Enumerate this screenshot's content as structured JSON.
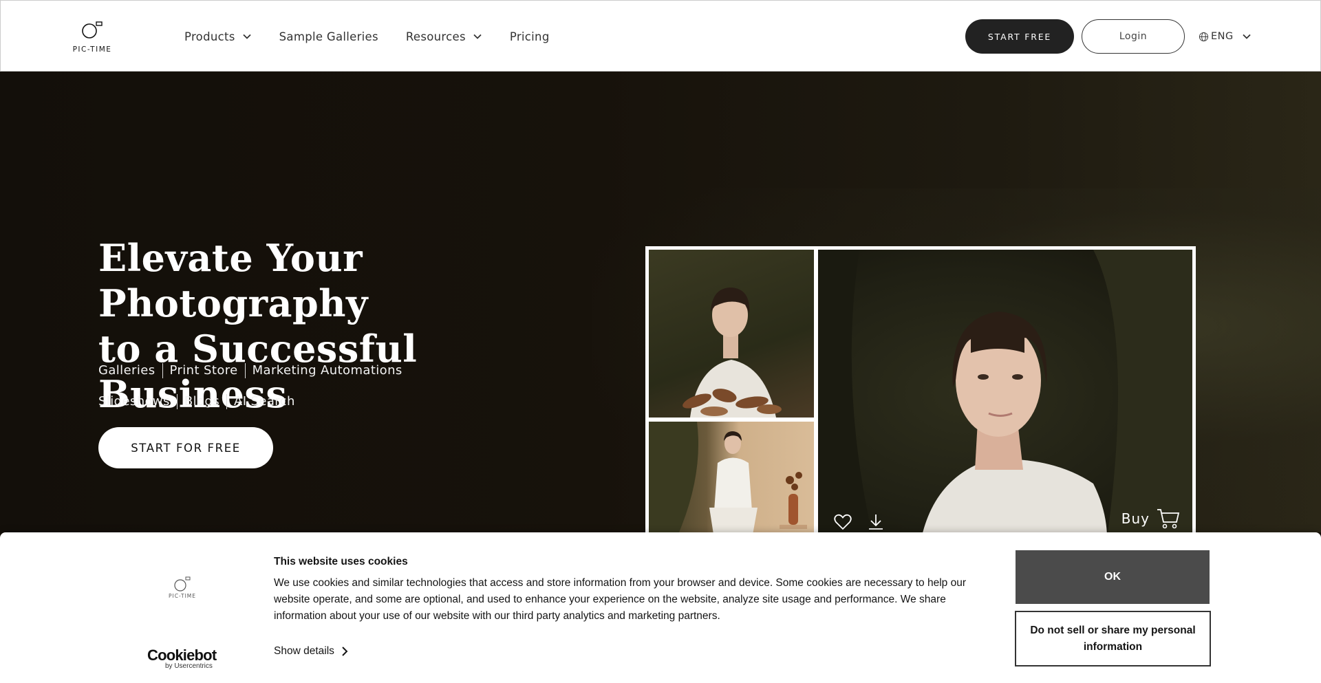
{
  "brand": {
    "name": "PIC-TIME"
  },
  "nav": {
    "items": [
      {
        "label": "Products",
        "has_dropdown": true
      },
      {
        "label": "Sample Galleries",
        "has_dropdown": false
      },
      {
        "label": "Resources",
        "has_dropdown": true
      },
      {
        "label": "Pricing",
        "has_dropdown": false
      }
    ],
    "start_free": "START FREE",
    "login": "Login",
    "language": "ENG"
  },
  "hero": {
    "title_line1": "Elevate Your Photography",
    "title_line2": "to a Successful Business",
    "features_row1": [
      "Galleries",
      "Print Store",
      "Marketing Automations"
    ],
    "features_row2": [
      "Slideshows",
      "Blogs",
      "AI Search"
    ],
    "cta": "START FOR FREE",
    "gallery_buy": "Buy"
  },
  "cookie": {
    "title": "This website uses cookies",
    "body": "We use cookies and similar technologies that access and store information from your browser and device. Some cookies are necessary to help our website operate, and some are optional, and used to enhance your experience on the website, analyze site usage and performance. We share information about your use of our website with our third party analytics and marketing partners.",
    "show_details": "Show details",
    "ok": "OK",
    "do_not_sell": "Do not sell or share my personal information",
    "provider": "Cookiebot",
    "provider_sub": "by Usercentrics"
  },
  "colors": {
    "nav_bg": "#ffffff",
    "hero_bg": "#15100a",
    "primary_button": "#222222",
    "cookie_ok": "#4b4b4b"
  },
  "icons": [
    "chevron-down-icon",
    "globe-icon",
    "heart-icon",
    "download-icon",
    "cart-icon",
    "chevron-right-icon"
  ]
}
